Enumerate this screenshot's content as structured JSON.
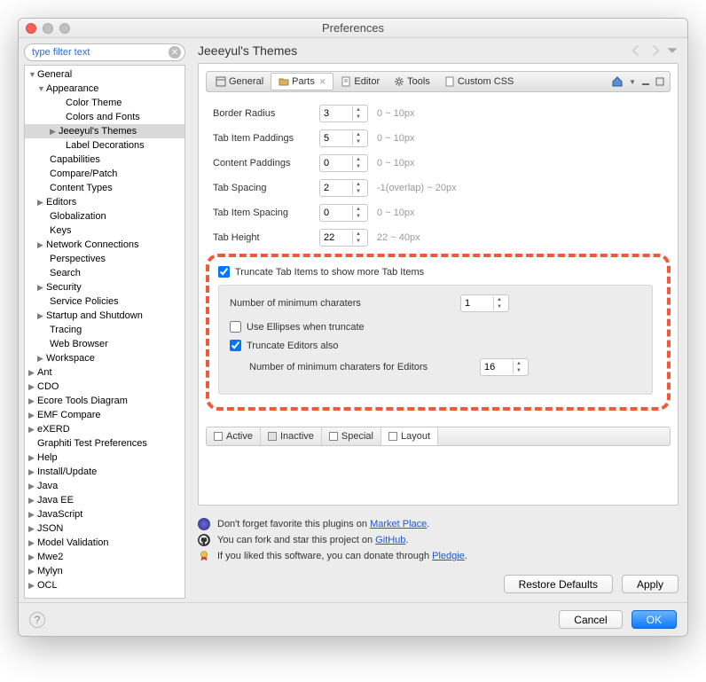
{
  "window": {
    "title": "Preferences"
  },
  "filter": {
    "placeholder": "type filter text"
  },
  "tree": {
    "general": "General",
    "appearance": "Appearance",
    "color_theme": "Color Theme",
    "colors_fonts": "Colors and Fonts",
    "jeeeyul": "Jeeeyul's Themes",
    "label_dec": "Label Decorations",
    "capabilities": "Capabilities",
    "compare": "Compare/Patch",
    "content_types": "Content Types",
    "editors": "Editors",
    "globalization": "Globalization",
    "keys": "Keys",
    "network": "Network Connections",
    "perspectives": "Perspectives",
    "search": "Search",
    "security": "Security",
    "service_policies": "Service Policies",
    "startup": "Startup and Shutdown",
    "tracing": "Tracing",
    "web_browser": "Web Browser",
    "workspace": "Workspace",
    "ant": "Ant",
    "cdo": "CDO",
    "ecore": "Ecore Tools Diagram",
    "emf": "EMF Compare",
    "exerd": "eXERD",
    "graphiti": "Graphiti Test Preferences",
    "help": "Help",
    "install": "Install/Update",
    "java": "Java",
    "javaee": "Java EE",
    "javascript": "JavaScript",
    "json": "JSON",
    "model_val": "Model Validation",
    "mwe2": "Mwe2",
    "mylyn": "Mylyn",
    "ocl": "OCL"
  },
  "page": {
    "title": "Jeeeyul's Themes"
  },
  "tabs": {
    "general": "General",
    "parts": "Parts",
    "editor": "Editor",
    "tools": "Tools",
    "custom": "Custom CSS"
  },
  "form": {
    "border_radius": {
      "label": "Border Radius",
      "value": "3",
      "hint": "0 ~ 10px"
    },
    "tab_item_paddings": {
      "label": "Tab Item Paddings",
      "value": "5",
      "hint": "0 ~ 10px"
    },
    "content_paddings": {
      "label": "Content Paddings",
      "value": "0",
      "hint": "0 ~ 10px"
    },
    "tab_spacing": {
      "label": "Tab Spacing",
      "value": "2",
      "hint": "-1(overlap) ~ 20px"
    },
    "tab_item_spacing": {
      "label": "Tab Item Spacing",
      "value": "0",
      "hint": "0 ~ 10px"
    },
    "tab_height": {
      "label": "Tab Height",
      "value": "22",
      "hint": "22 ~ 40px"
    }
  },
  "truncate": {
    "main": "Truncate Tab Items to show more Tab Items",
    "min_chars_label": "Number of minimum charaters",
    "min_chars_value": "1",
    "ellipses": "Use Ellipses when truncate",
    "editors_also": "Truncate Editors also",
    "min_chars_editors_label": "Number of minimum charaters for Editors",
    "min_chars_editors_value": "16"
  },
  "bottom_tabs": {
    "active": "Active",
    "inactive": "Inactive",
    "special": "Special",
    "layout": "Layout"
  },
  "tips": {
    "t1a": "Don't forget favorite this plugins on ",
    "t1b": "Market Place",
    "t2a": "You can fork and star this project on ",
    "t2b": "GitHub",
    "t3a": "If you liked this software, you can donate through ",
    "t3b": "Pledgie"
  },
  "buttons": {
    "restore": "Restore Defaults",
    "apply": "Apply",
    "cancel": "Cancel",
    "ok": "OK"
  }
}
